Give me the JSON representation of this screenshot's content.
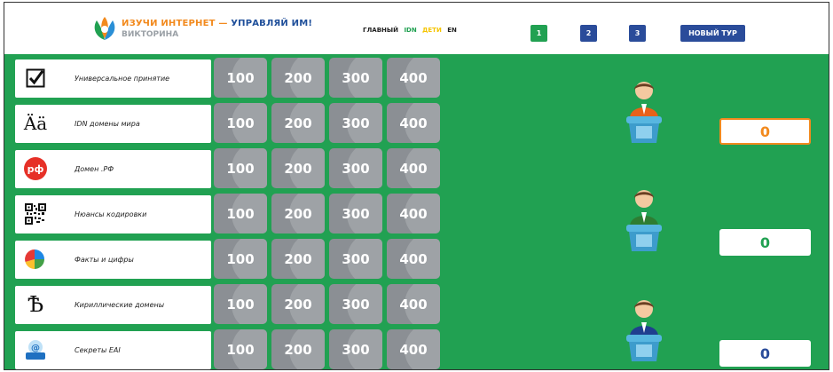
{
  "header": {
    "logo_icon": "quiz-logo",
    "title_part1": "ИЗУЧИ ИНТЕРНЕТ —",
    "title_part2": "УПРАВЛЯЙ ИМ!",
    "subtitle": "ВИКТОРИНА",
    "languages": [
      "ГЛАВНЫЙ",
      "IDN",
      "ДЕТИ",
      "EN"
    ],
    "rounds": [
      "1",
      "2",
      "3"
    ],
    "active_round": "1",
    "new_tour_label": "НОВЫЙ ТУР"
  },
  "categories": [
    {
      "label": "Универсальное принятие",
      "icon": "checkbox-icon"
    },
    {
      "label": "IDN домены мира",
      "icon": "umlaut-letters-icon",
      "icon_text": "Ää"
    },
    {
      "label": "Домен .РФ",
      "icon": "rf-domain-icon",
      "icon_text": "рф"
    },
    {
      "label": "Нюансы кодировки",
      "icon": "qr-code-icon"
    },
    {
      "label": "Факты и цифры",
      "icon": "pie-chart-icon"
    },
    {
      "label": "Кириллические домены",
      "icon": "cyrillic-yat-icon",
      "icon_text": "Ѣ"
    },
    {
      "label": "Секреты EAI",
      "icon": "email-icon"
    }
  ],
  "point_values": [
    "100",
    "200",
    "300",
    "400"
  ],
  "players": [
    {
      "score": "0",
      "icon": "player-avatar-orange",
      "active": true
    },
    {
      "score": "0",
      "icon": "player-avatar-green",
      "active": false
    },
    {
      "score": "0",
      "icon": "player-avatar-blue",
      "active": false
    }
  ],
  "colors": {
    "board": "#21a152",
    "accent_orange": "#f28a1e",
    "accent_blue": "#2a4c9a",
    "cell": "#8b8f94"
  }
}
